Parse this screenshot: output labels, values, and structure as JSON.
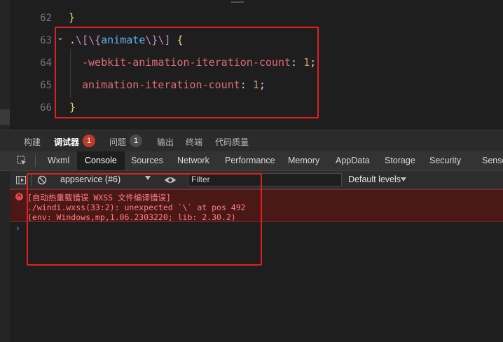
{
  "editor": {
    "lines": [
      {
        "num": "62",
        "code": "}"
      },
      {
        "num": "63",
        "selector_dot": ".",
        "selector_open": "\\[",
        "selector_open2": "\\{",
        "selector_id": "animate",
        "selector_close": "\\}",
        "selector_close2": "\\]",
        "brace": " {"
      },
      {
        "num": "64",
        "prop": "-webkit-animation-iteration-count",
        "colon": ": ",
        "value": "1",
        "semi": ";"
      },
      {
        "num": "65",
        "prop": "animation-iteration-count",
        "colon": ": ",
        "value": "1",
        "semi": ";"
      },
      {
        "num": "66",
        "code": "}"
      }
    ],
    "fold_marker": "⌄"
  },
  "devtools": {
    "outer_tabs": [
      {
        "label": "构建"
      },
      {
        "label": "调试器",
        "badge": "1",
        "badge_color": "#c0392b"
      },
      {
        "label": "问题",
        "badge": "1",
        "badge_color": "#4a4a4a"
      },
      {
        "label": "输出"
      },
      {
        "label": "终端"
      },
      {
        "label": "代码质量"
      }
    ],
    "panel_tabs": [
      "Wxml",
      "Console",
      "Sources",
      "Network",
      "Performance",
      "Memory",
      "AppData",
      "Storage",
      "Security",
      "Senso"
    ],
    "active_panel": "Console",
    "toolbar": {
      "context": "appservice (#6)",
      "filter_placeholder": "Filter",
      "levels": "Default levels"
    },
    "console": {
      "error_lines": [
        "[自动热重载错误 WXSS 文件编译错误]",
        "./windi.wxss(33:2): unexpected `\\` at pos 492",
        "(env: Windows,mp,1.06.2303220; lib: 2.30.2)"
      ],
      "prompt": "›"
    }
  },
  "colors": {
    "highlight_box": "#e02020",
    "error_bg": "#4b1818",
    "error_text": "#ff8080"
  }
}
